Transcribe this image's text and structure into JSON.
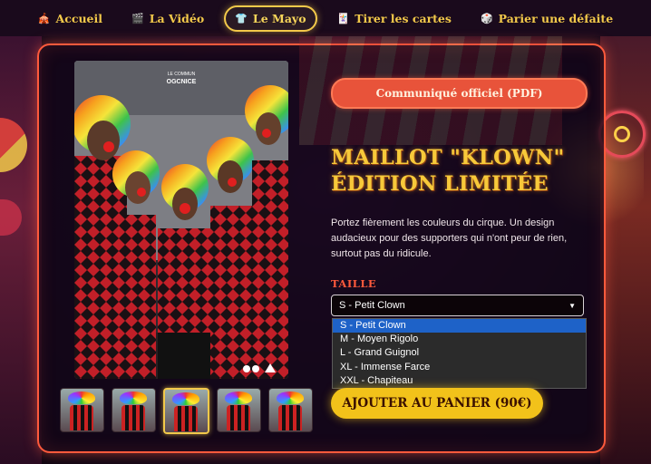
{
  "nav": {
    "items": [
      {
        "label": "Accueil",
        "icon": "tent-icon",
        "glyph": "🎪",
        "active": false
      },
      {
        "label": "La Vidéo",
        "icon": "clapper-icon",
        "glyph": "🎬",
        "active": false
      },
      {
        "label": "Le Mayo",
        "icon": "shirt-icon",
        "glyph": "👕",
        "active": true
      },
      {
        "label": "Tirer les cartes",
        "icon": "cards-icon",
        "glyph": "🃏",
        "active": false
      },
      {
        "label": "Parier une défaite",
        "icon": "dice-icon",
        "glyph": "🎲",
        "active": false
      }
    ]
  },
  "product": {
    "pdf_button": "Communiqué officiel (PDF)",
    "title_line1": "MAILLOT \"KLOWN\"",
    "title_line2": "ÉDITION LIMITÉE",
    "description": "Portez fièrement les couleurs du cirque. Un design audacieux pour des supporters qui n'ont peur de rien, surtout pas du ridicule.",
    "size_label": "TAILLE",
    "selected_size": "S - Petit Clown",
    "size_options": [
      "S - Petit Clown",
      "M - Moyen Rigolo",
      "L - Grand Guignol",
      "XL - Immense Farce",
      "XXL - Chapiteau"
    ],
    "cart_button": "AJOUTER AU PANIER (90€)",
    "jersey_brand": "OGCNICE",
    "jersey_tag": "LE COMMUN",
    "thumbnails_count": 5,
    "active_thumbnail": 3
  },
  "colors": {
    "accent": "#f2c94a",
    "panel_border": "#ff5a3c",
    "cta": "#f2c21a",
    "pdf_button": "#e8533a"
  }
}
